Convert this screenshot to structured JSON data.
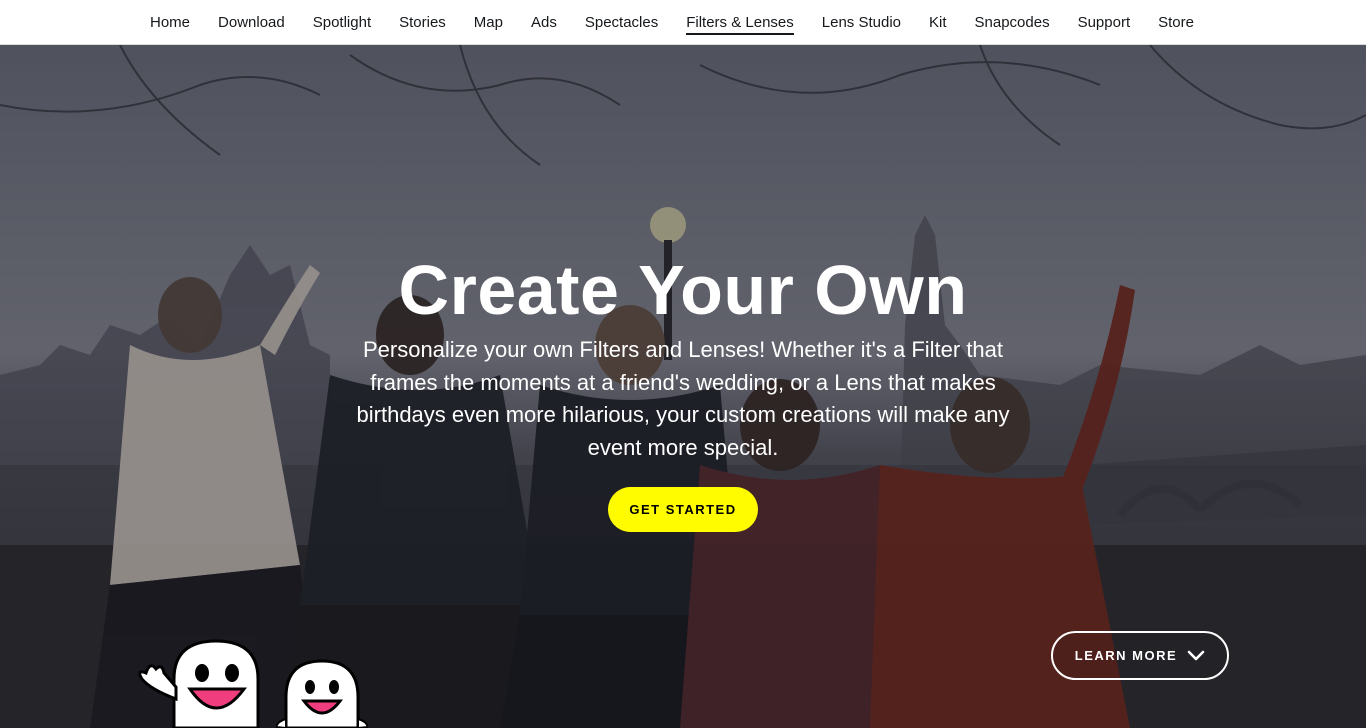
{
  "nav": {
    "items": [
      {
        "label": "Home"
      },
      {
        "label": "Download"
      },
      {
        "label": "Spotlight"
      },
      {
        "label": "Stories"
      },
      {
        "label": "Map"
      },
      {
        "label": "Ads"
      },
      {
        "label": "Spectacles"
      },
      {
        "label": "Filters & Lenses",
        "active": true
      },
      {
        "label": "Lens Studio"
      },
      {
        "label": "Kit"
      },
      {
        "label": "Snapcodes"
      },
      {
        "label": "Support"
      },
      {
        "label": "Store"
      }
    ]
  },
  "hero": {
    "title": "Create Your Own",
    "description": "Personalize your own Filters and Lenses! Whether it's a Filter that frames the moments at a friend's wedding, or a Lens that makes birthdays even more hilarious, your custom creations will make any event more special.",
    "cta_label": "GET STARTED",
    "learn_more_label": "LEARN MORE"
  },
  "colors": {
    "accent_yellow": "#fffc00",
    "nav_text": "#16191c"
  },
  "icons": [
    "chevron-down-icon",
    "ghost-mascot-icon"
  ]
}
